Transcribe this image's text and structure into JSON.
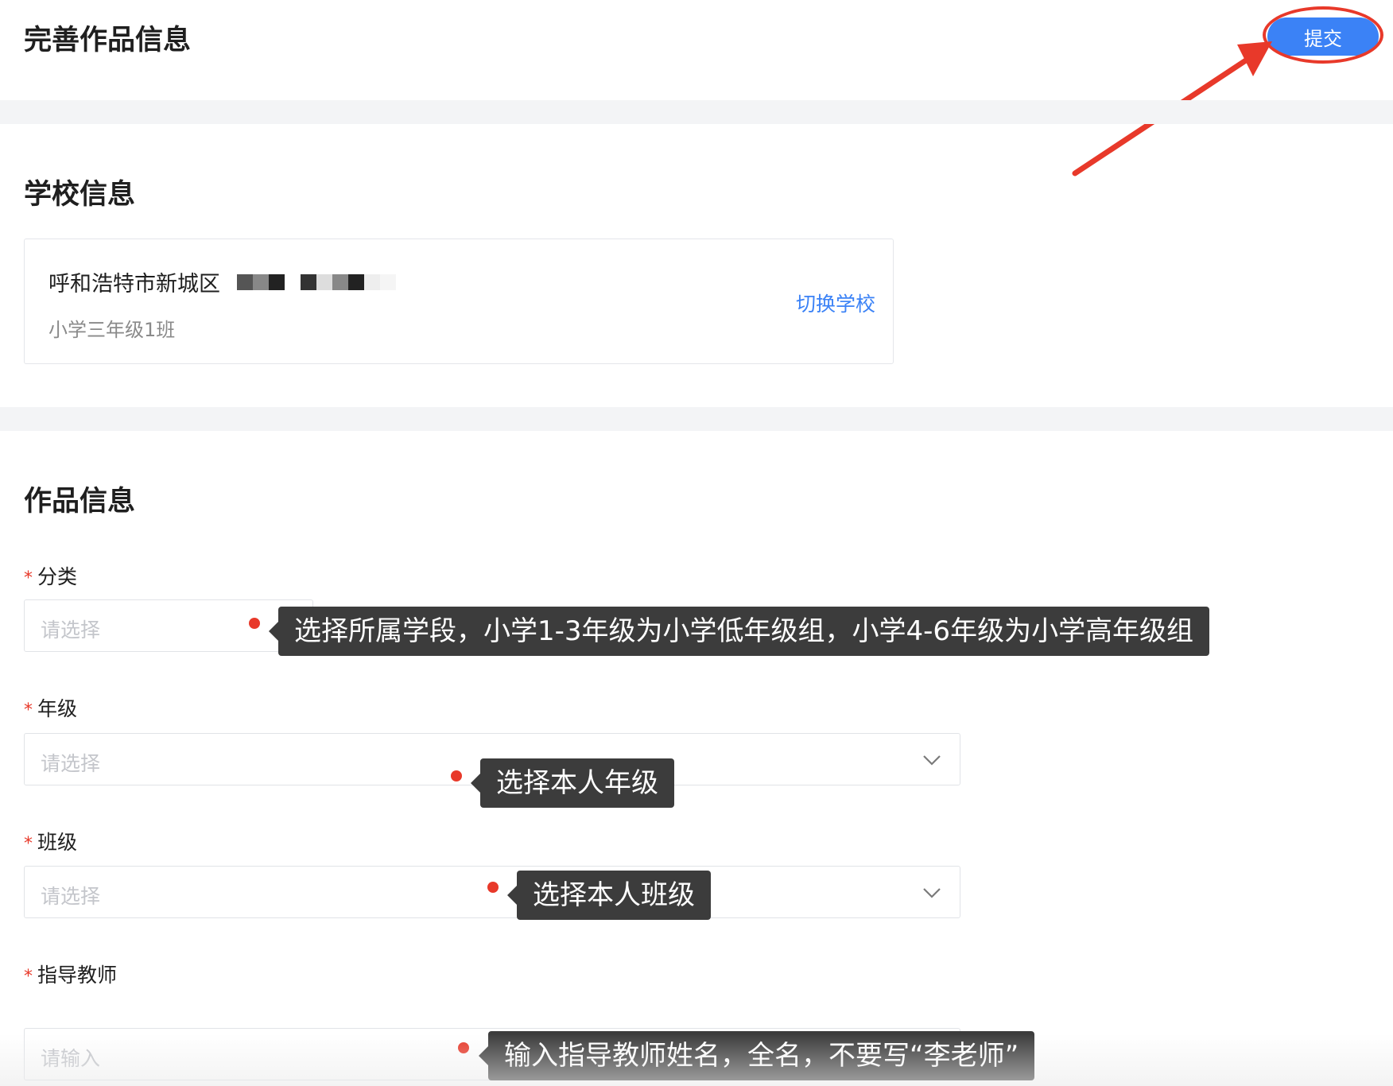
{
  "header": {
    "title": "完善作品信息",
    "submit_label": "提交"
  },
  "school_section": {
    "title": "学校信息",
    "school_name": "呼和浩特市新城区",
    "class_line": "小学三年级1班",
    "switch_label": "切换学校"
  },
  "work_section": {
    "title": "作品信息",
    "fields": [
      {
        "label": "分类",
        "placeholder": "请选择",
        "required": "*"
      },
      {
        "label": "年级",
        "placeholder": "请选择",
        "required": "*"
      },
      {
        "label": "班级",
        "placeholder": "请选择",
        "required": "*"
      },
      {
        "label": "指导教师",
        "placeholder": "请输入",
        "required": "*"
      }
    ]
  },
  "annotations": {
    "category_tip": "选择所属学段，小学1-3年级为小学低年级组，小学4-6年级为小学高年级组",
    "grade_tip": "选择本人年级",
    "class_tip": "选择本人班级",
    "teacher_tip": "输入指导教师姓名，全名，不要写“李老师”"
  },
  "colors": {
    "accent": "#3b82f6",
    "annotation_red": "#e8392a",
    "tooltip_bg": "#3c3c3c",
    "section_gap": "#f3f4f6"
  },
  "icons": [
    "chevron-down-icon",
    "arrow-annotation"
  ]
}
